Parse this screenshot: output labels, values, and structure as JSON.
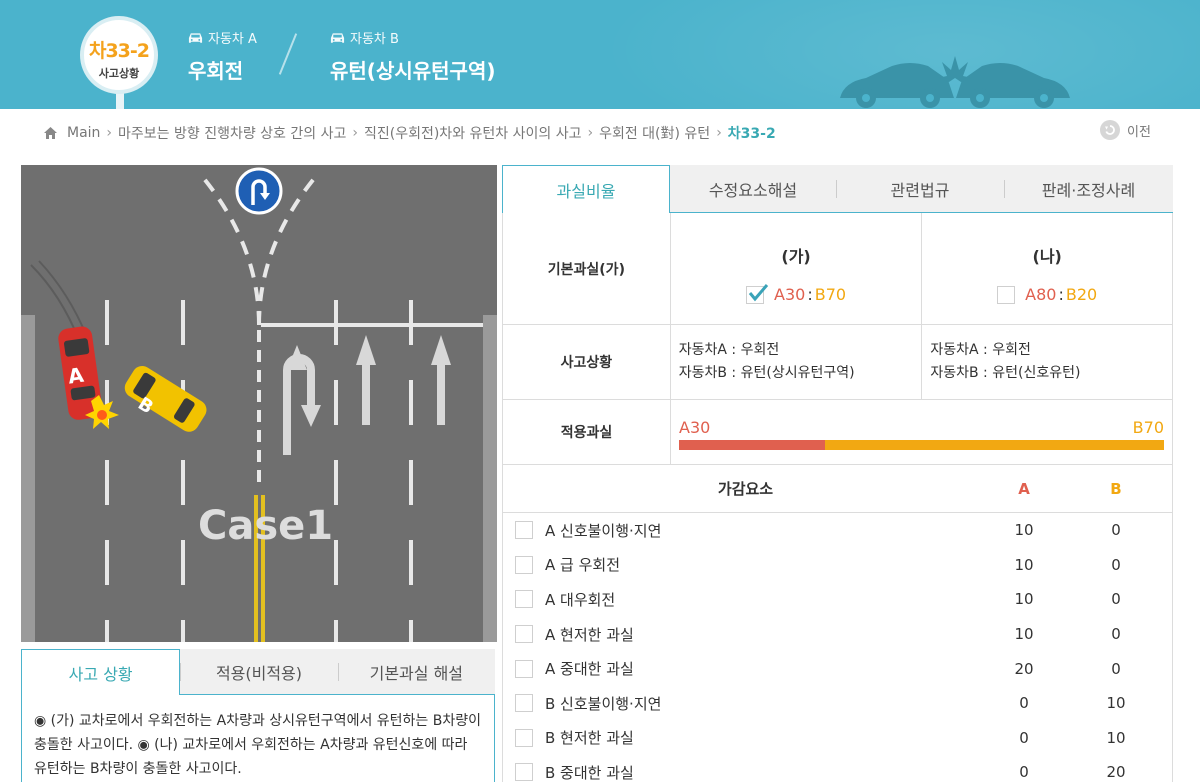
{
  "header": {
    "case_code": "차33-2",
    "case_sub": "사고상황",
    "vehicle_a_label": "자동차 A",
    "vehicle_a_value": "우회전",
    "vehicle_b_label": "자동차 B",
    "vehicle_b_value": "유턴(상시유턴구역)",
    "bg_color": "#4bb3cc"
  },
  "breadcrumb": {
    "items": [
      "Main",
      "마주보는 방향 진행차량 상호 간의 사고",
      "직진(우회전)차와 유턴차 사이의 사고",
      "우회전 대(對) 유턴"
    ],
    "current": "차33-2"
  },
  "prev_button": {
    "label": "이전"
  },
  "scene": {
    "case_label": "Case1",
    "car_a": "A",
    "car_b": "B",
    "car_a_color": "#d8302a",
    "car_b_color": "#f2c200"
  },
  "left_tabs": [
    {
      "label": "사고 상황",
      "active": true
    },
    {
      "label": "적용(비적용)",
      "active": false
    },
    {
      "label": "기본과실 해설",
      "active": false
    }
  ],
  "left_desc": "◉ (가) 교차로에서 우회전하는 A차량과 상시유턴구역에서 유턴하는 B차량이 충돌한 사고이다. ◉ (나) 교차로에서 우회전하는 A차량과 유턴신호에 따라 유턴하는 B차량이 충돌한 사고이다.",
  "right_tabs": [
    {
      "label": "과실비율",
      "active": true
    },
    {
      "label": "수정요소해설",
      "active": false
    },
    {
      "label": "관련법규",
      "active": false
    },
    {
      "label": "판례·조정사례",
      "active": false
    }
  ],
  "panel": {
    "base_label": "기본과실(가)",
    "case_ga": {
      "title": "(가)",
      "a": "A30",
      "colon": ":",
      "b": "B70",
      "checked": true
    },
    "case_na": {
      "title": "(나)",
      "a": "A80",
      "colon": ":",
      "b": "B20",
      "checked": false
    },
    "situation_label": "사고상황",
    "situation_ga": [
      "자동차A : 우회전",
      "자동차B : 유턴(상시유턴구역)"
    ],
    "situation_na": [
      "자동차A : 우회전",
      "자동차B : 유턴(신호유턴)"
    ],
    "applied_label": "적용과실",
    "applied_a": "A30",
    "applied_b": "B70",
    "applied_a_fraction": 0.3,
    "color_a": "#e0604f",
    "color_b": "#f2a812",
    "adj_title": "가감요소",
    "adj_col_a": "A",
    "adj_col_b": "B",
    "adjustments": [
      {
        "name": "A 신호불이행·지연",
        "a": "10",
        "b": "0"
      },
      {
        "name": "A 급 우회전",
        "a": "10",
        "b": "0"
      },
      {
        "name": "A 대우회전",
        "a": "10",
        "b": "0"
      },
      {
        "name": "A 현저한 과실",
        "a": "10",
        "b": "0"
      },
      {
        "name": "A 중대한 과실",
        "a": "20",
        "b": "0"
      },
      {
        "name": "B 신호불이행·지연",
        "a": "0",
        "b": "10"
      },
      {
        "name": "B 현저한 과실",
        "a": "0",
        "b": "10"
      },
      {
        "name": "B 중대한 과실",
        "a": "0",
        "b": "20"
      }
    ]
  }
}
